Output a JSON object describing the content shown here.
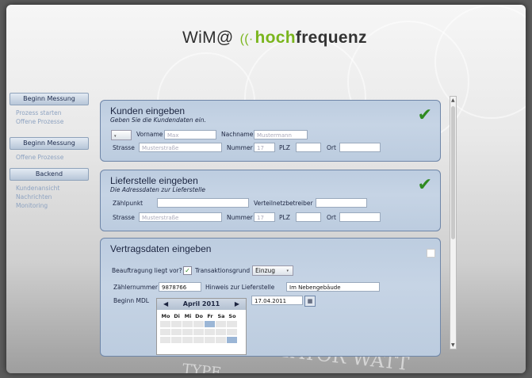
{
  "logo": {
    "prefix": "WiM@",
    "wave": "((·",
    "hoch": "hoch",
    "freq": "frequenz"
  },
  "background": {
    "meter_text": "SINGLE-STATOR WATT",
    "meter_type": "TYPE"
  },
  "sidebar": {
    "groups": [
      {
        "button": "Beginn Messung",
        "links": [
          "Prozess starten",
          "Offene Prozesse"
        ]
      },
      {
        "button": "Beginn Messung",
        "links": [
          "Offene Prozesse"
        ]
      },
      {
        "button": "Backend",
        "links": [
          "Kundenansicht",
          "Nachrichten",
          "Monitoring"
        ]
      }
    ]
  },
  "kunden": {
    "title": "Kunden eingeben",
    "subtitle": "Geben Sie die Kundendaten ein.",
    "salutation_select": "",
    "vorname_label": "Vorname",
    "vorname_placeholder": "Max",
    "nachname_label": "Nachname",
    "nachname_placeholder": "Mustermann",
    "strasse_label": "Strasse",
    "strasse_placeholder": "Musterstraße",
    "nummer_label": "Nummer",
    "nummer_placeholder": "17",
    "plz_label": "PLZ",
    "ort_label": "Ort"
  },
  "liefer": {
    "title": "Lieferstelle eingeben",
    "subtitle": "Die Adressdaten zur Lieferstelle",
    "zaehlpunkt_label": "Zählpunkt",
    "vnb_label": "Verteilnetzbetreiber",
    "strasse_label": "Strasse",
    "strasse_placeholder": "Musterstraße",
    "nummer_label": "Nummer",
    "nummer_placeholder": "17",
    "plz_label": "PLZ",
    "ort_label": "Ort"
  },
  "vertrag": {
    "title": "Vertragsdaten eingeben",
    "beauftragung_label": "Beauftragung liegt vor?",
    "beauftragung_checked": "✓",
    "transaktionsgrund_label": "Transaktionsgrund",
    "transaktionsgrund_value": "Einzug",
    "zaehlernummer_label": "Zählernummer",
    "zaehlernummer_value": "9878766",
    "hinweis_label": "Hinweis zur Lieferstelle",
    "hinweis_value": "Im Nebengebäude",
    "beginn_label": "Beginn MDL",
    "beginn_value": "17.04.2011",
    "calendar_icon": "calendar-icon",
    "calendar": {
      "month": "April 2011",
      "prev": "◀",
      "next": "▶",
      "weekdays": [
        "Mo",
        "Di",
        "Mi",
        "Do",
        "Fr",
        "Sa",
        "So"
      ]
    }
  },
  "colors": {
    "accent_green": "#7ab51d",
    "panel_border": "#6f86a8",
    "panel_bg": "#c3d2e3"
  }
}
